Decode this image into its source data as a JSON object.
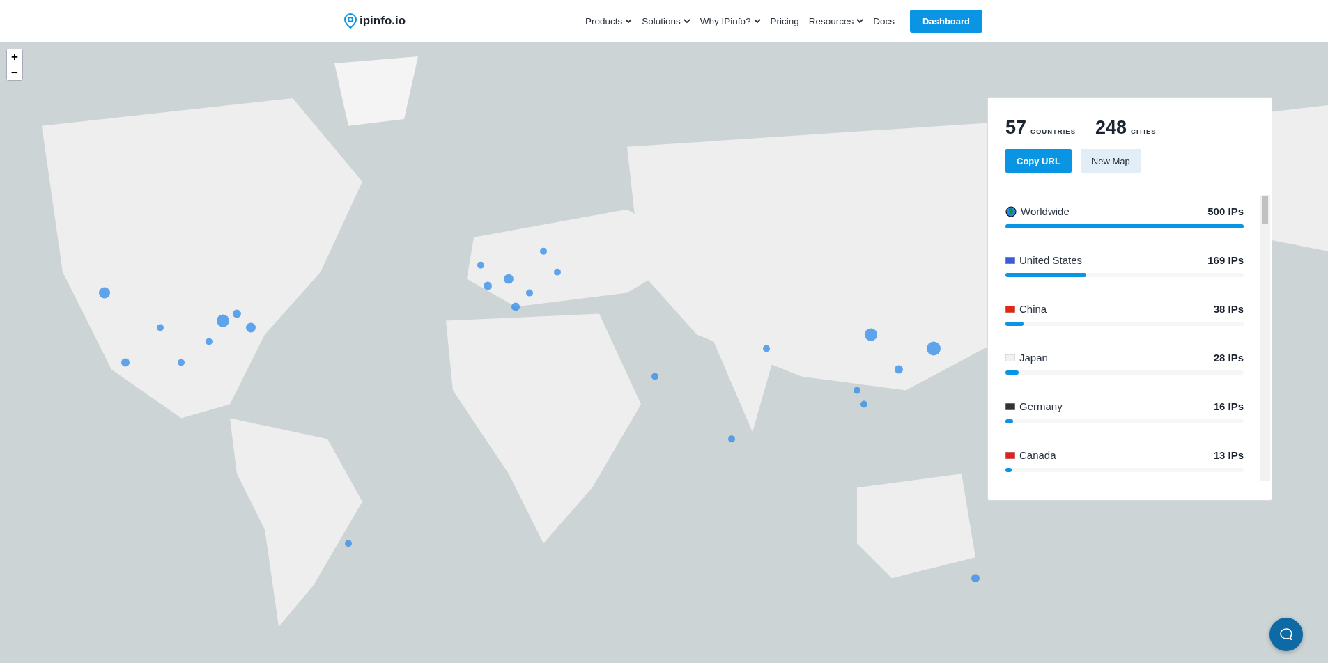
{
  "header": {
    "logo": "ipinfo.io",
    "nav": [
      {
        "label": "Products",
        "dropdown": true
      },
      {
        "label": "Solutions",
        "dropdown": true
      },
      {
        "label": "Why IPinfo?",
        "dropdown": true
      },
      {
        "label": "Pricing",
        "dropdown": false
      },
      {
        "label": "Resources",
        "dropdown": true
      },
      {
        "label": "Docs",
        "dropdown": false
      }
    ],
    "cta": "Dashboard"
  },
  "map": {
    "kind": "picture",
    "zoom_in": "+",
    "zoom_out": "−"
  },
  "summary": {
    "countries": "57",
    "countries_label": "COUNTRIES",
    "cities": "248",
    "cities_label": "CITIES",
    "copy_button": "Copy URL",
    "new_button": "New Map"
  },
  "locations": [
    {
      "kind": "globe",
      "name": "Worldwide",
      "count": "500 IPs",
      "level": 1
    },
    {
      "kind": "flag",
      "name": "United States",
      "count": "169 IPs",
      "level": 0.338,
      "color": "#3c5bd6"
    },
    {
      "kind": "flag",
      "name": "China",
      "count": "38 IPs",
      "level": 0.076,
      "color": "#de2910"
    },
    {
      "kind": "flag",
      "name": "Japan",
      "count": "28 IPs",
      "level": 0.056,
      "color": "#f2f2f2"
    },
    {
      "kind": "flag",
      "name": "Germany",
      "count": "16 IPs",
      "level": 0.032,
      "color": "#333333"
    },
    {
      "kind": "flag",
      "name": "Canada",
      "count": "13 IPs",
      "level": 0.026,
      "color": "#e02020"
    }
  ]
}
